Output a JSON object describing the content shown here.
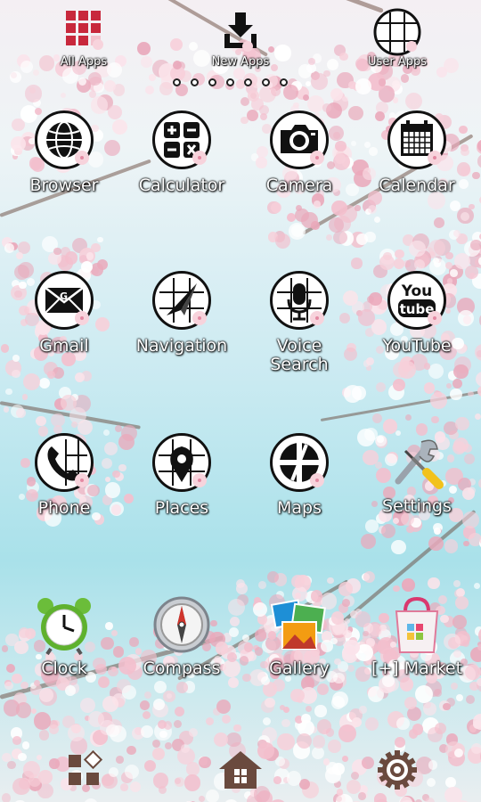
{
  "top_bar": {
    "all_apps": "All Apps",
    "new_apps": "New Apps",
    "user_apps": "User Apps"
  },
  "page_indicator": {
    "count": 7
  },
  "apps": [
    {
      "name": "Browser",
      "icon": "globe-icon"
    },
    {
      "name": "Calculator",
      "icon": "calculator-icon"
    },
    {
      "name": "Camera",
      "icon": "camera-icon"
    },
    {
      "name": "Calendar",
      "icon": "calendar-icon"
    },
    {
      "name": "Gmail",
      "icon": "mail-icon"
    },
    {
      "name": "Navigation",
      "icon": "navigation-arrow-icon"
    },
    {
      "name": "Voice\nSearch",
      "icon": "microphone-icon"
    },
    {
      "name": "YouTube",
      "icon": "youtube-icon"
    },
    {
      "name": "Phone",
      "icon": "phone-icon"
    },
    {
      "name": "Places",
      "icon": "map-pin-icon"
    },
    {
      "name": "Maps",
      "icon": "road-map-icon"
    },
    {
      "name": "Settings",
      "icon": "wrench-screwdriver-icon"
    },
    {
      "name": "Clock",
      "icon": "alarm-clock-icon"
    },
    {
      "name": "Compass",
      "icon": "compass-icon"
    },
    {
      "name": "Gallery",
      "icon": "photos-icon"
    },
    {
      "name": "[+] Market",
      "icon": "shopping-bag-icon"
    }
  ],
  "youtube_icon_text": {
    "top": "You",
    "bottom": "tube"
  },
  "dock": [
    "widgets-icon",
    "home-icon",
    "gear-icon"
  ],
  "colors": {
    "petal": "#f5c6d2",
    "dark": "#111111",
    "wood": "#6a4a3e"
  }
}
